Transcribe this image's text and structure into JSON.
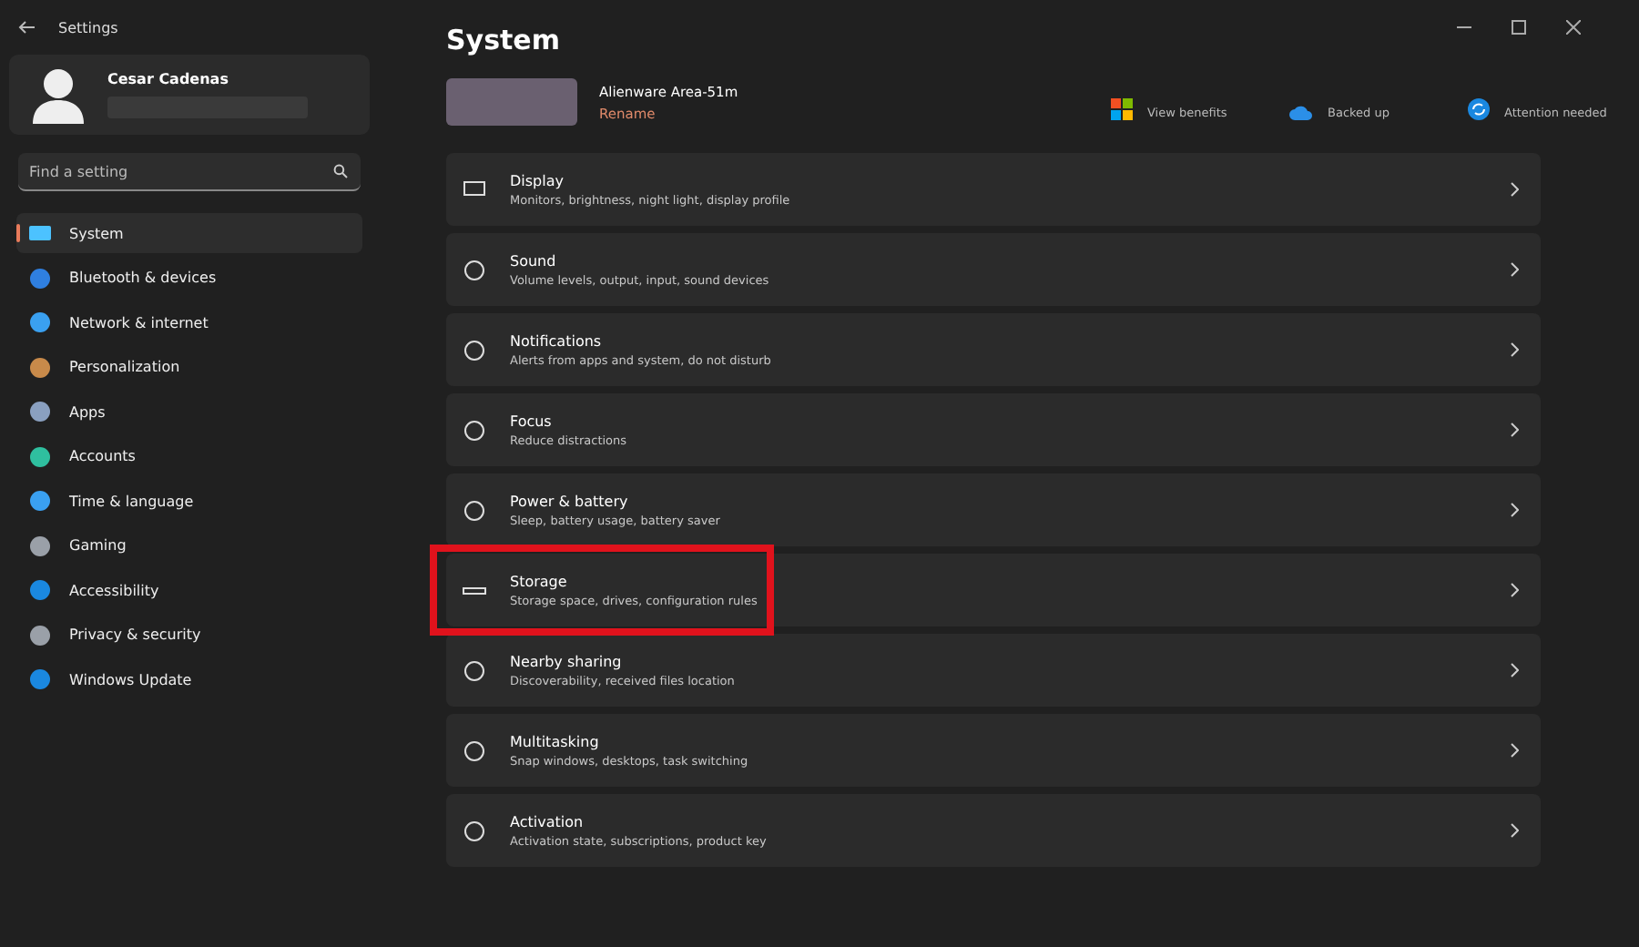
{
  "window": {
    "title": "Settings"
  },
  "account": {
    "name": "Cesar Cadenas"
  },
  "search": {
    "placeholder": "Find a setting"
  },
  "sidebar": {
    "items": [
      {
        "label": "System",
        "selected": true
      },
      {
        "label": "Bluetooth & devices",
        "selected": false
      },
      {
        "label": "Network & internet",
        "selected": false
      },
      {
        "label": "Personalization",
        "selected": false
      },
      {
        "label": "Apps",
        "selected": false
      },
      {
        "label": "Accounts",
        "selected": false
      },
      {
        "label": "Time & language",
        "selected": false
      },
      {
        "label": "Gaming",
        "selected": false
      },
      {
        "label": "Accessibility",
        "selected": false
      },
      {
        "label": "Privacy & security",
        "selected": false
      },
      {
        "label": "Windows Update",
        "selected": false
      }
    ]
  },
  "page": {
    "title": "System"
  },
  "device": {
    "name": "Alienware Area-51m",
    "rename": "Rename"
  },
  "status_tiles": [
    {
      "subtitle": "View benefits"
    },
    {
      "subtitle": "Backed up"
    },
    {
      "subtitle": "Attention needed"
    }
  ],
  "settings": [
    {
      "title": "Display",
      "subtitle": "Monitors, brightness, night light, display profile",
      "highlighted": false
    },
    {
      "title": "Sound",
      "subtitle": "Volume levels, output, input, sound devices",
      "highlighted": false
    },
    {
      "title": "Notifications",
      "subtitle": "Alerts from apps and system, do not disturb",
      "highlighted": false
    },
    {
      "title": "Focus",
      "subtitle": "Reduce distractions",
      "highlighted": false
    },
    {
      "title": "Power & battery",
      "subtitle": "Sleep, battery usage, battery saver",
      "highlighted": false
    },
    {
      "title": "Storage",
      "subtitle": "Storage space, drives, configuration rules",
      "highlighted": true
    },
    {
      "title": "Nearby sharing",
      "subtitle": "Discoverability, received files location",
      "highlighted": false
    },
    {
      "title": "Multitasking",
      "subtitle": "Snap windows, desktops, task switching",
      "highlighted": false
    },
    {
      "title": "Activation",
      "subtitle": "Activation state, subscriptions, product key",
      "highlighted": false
    }
  ]
}
